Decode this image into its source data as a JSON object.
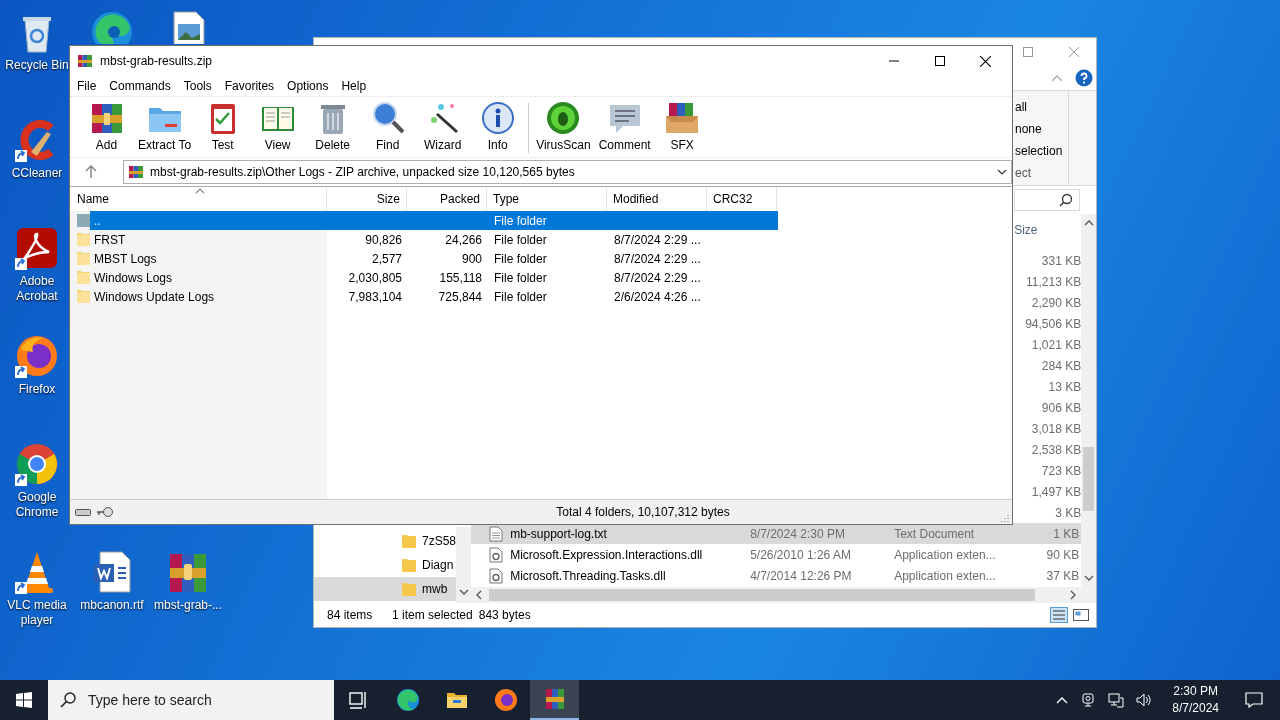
{
  "desktop_icons": [
    {
      "kind": "recycle",
      "label": "Recycle Bin",
      "shortcut": false
    },
    {
      "kind": "edge",
      "shortcut": false
    },
    {
      "kind": "image",
      "shortcut": false
    },
    {
      "kind": "ccleaner",
      "label": "CCleaner",
      "shortcut": true
    },
    {
      "kind": "acrobat",
      "label": "Adobe Acrobat",
      "shortcut": true
    },
    {
      "kind": "firefox",
      "label": "Firefox",
      "shortcut": true
    },
    {
      "kind": "chrome",
      "label": "Google Chrome",
      "shortcut": true
    },
    {
      "kind": "vlc",
      "label": "VLC media player",
      "shortcut": true
    },
    {
      "kind": "word",
      "label": "mbcanon.rtf",
      "shortcut": false
    },
    {
      "kind": "rar",
      "label": "mbst-grab-...",
      "shortcut": false
    }
  ],
  "explorer": {
    "ribbon": {
      "commands": [
        "all",
        "none",
        "selection"
      ],
      "group_label": "ect"
    },
    "size_column": "Size",
    "files": [
      {
        "size": "331 KB",
        "selected": false
      },
      {
        "size": "11,213 KB",
        "selected": false
      },
      {
        "size": "2,290 KB",
        "selected": false
      },
      {
        "size": "94,506 KB",
        "selected": false
      },
      {
        "size": "1,021 KB",
        "selected": false
      },
      {
        "size": "284 KB",
        "selected": false
      },
      {
        "size": "13 KB",
        "selected": false
      },
      {
        "size": "906 KB",
        "selected": false
      },
      {
        "size": "3,018 KB",
        "selected": false
      },
      {
        "size": "2,538 KB",
        "selected": false
      },
      {
        "size": "723 KB",
        "selected": false
      },
      {
        "size": "1,497 KB",
        "selected": false
      },
      {
        "size": "3 KB",
        "selected": false
      },
      {
        "kind": "text",
        "name": "mb-support-log.txt",
        "modified": "8/7/2024 2:30 PM",
        "type": "Text Document",
        "size": "1 KB",
        "selected": true
      },
      {
        "kind": "dll",
        "name": "Microsoft.Expression.Interactions.dll",
        "modified": "5/26/2010 1:26 AM",
        "type": "Application exten...",
        "size": "90 KB",
        "selected": false
      },
      {
        "kind": "dll",
        "name": "Microsoft.Threading.Tasks.dll",
        "modified": "4/7/2014 12:26 PM",
        "type": "Application exten...",
        "size": "37 KB",
        "selected": false
      }
    ],
    "nav_folders": [
      {
        "name": "7zS58",
        "selected": false
      },
      {
        "name": "Diagn",
        "selected": false
      },
      {
        "name": "mwb",
        "selected": true
      }
    ],
    "status": [
      "84 items",
      "1 item selected",
      "843 bytes"
    ]
  },
  "winrar": {
    "title": "mbst-grab-results.zip",
    "menu": [
      "File",
      "Commands",
      "Tools",
      "Favorites",
      "Options",
      "Help"
    ],
    "toolbar": [
      {
        "kind": "add",
        "label": "Add"
      },
      {
        "kind": "extract",
        "label": "Extract To"
      },
      {
        "kind": "test",
        "label": "Test"
      },
      {
        "kind": "view",
        "label": "View"
      },
      {
        "kind": "delete",
        "label": "Delete"
      },
      {
        "kind": "find",
        "label": "Find"
      },
      {
        "kind": "wizard",
        "label": "Wizard"
      },
      {
        "kind": "info",
        "label": "Info"
      },
      {
        "kind": "virusscan",
        "label": "VirusScan"
      },
      {
        "kind": "comment",
        "label": "Comment"
      },
      {
        "kind": "sfx",
        "label": "SFX"
      }
    ],
    "address": "mbst-grab-results.zip\\Other Logs - ZIP archive, unpacked size 10,120,565 bytes",
    "columns": [
      "Name",
      "Size",
      "Packed",
      "Type",
      "Modified",
      "CRC32"
    ],
    "rows": [
      {
        "kind": "parent",
        "name": "..",
        "type": "File folder",
        "selected": true
      },
      {
        "kind": "folder",
        "name": "FRST",
        "size": "90,826",
        "packed": "24,266",
        "type": "File folder",
        "modified": "8/7/2024 2:29 ...",
        "selected": false
      },
      {
        "kind": "folder",
        "name": "MBST Logs",
        "size": "2,577",
        "packed": "900",
        "type": "File folder",
        "modified": "8/7/2024 2:29 ...",
        "selected": false
      },
      {
        "kind": "folder",
        "name": "Windows Logs",
        "size": "2,030,805",
        "packed": "155,118",
        "type": "File folder",
        "modified": "8/7/2024 2:29 ...",
        "selected": false
      },
      {
        "kind": "folder",
        "name": "Windows Update Logs",
        "size": "7,983,104",
        "packed": "725,844",
        "type": "File folder",
        "modified": "2/6/2024 4:26 ...",
        "selected": false
      }
    ],
    "status": "Total 4 folders, 10,107,312 bytes"
  },
  "taskbar": {
    "search": {
      "placeholder": "Type here to search"
    },
    "apps": [
      {
        "kind": "taskview",
        "active": false
      },
      {
        "kind": "edge",
        "active": false
      },
      {
        "kind": "explorer",
        "active": false
      },
      {
        "kind": "firefox",
        "active": false
      },
      {
        "kind": "winrar",
        "active": true
      }
    ],
    "time": "2:30 PM",
    "date": "8/7/2024"
  }
}
